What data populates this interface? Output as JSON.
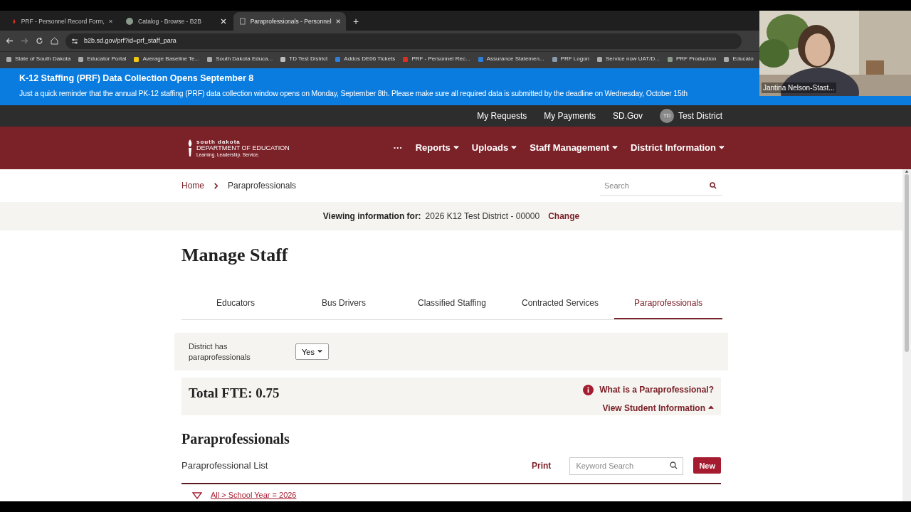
{
  "browser": {
    "tabs": [
      {
        "title": "PRF - Personnel Record Form,",
        "selected": false
      },
      {
        "title": "Catalog - Browse - B2B",
        "selected": false
      },
      {
        "title": "Paraprofessionals - Personnel",
        "selected": true
      }
    ],
    "new_tab": "+",
    "url": "b2b.sd.gov/prf?id=prf_staff_para",
    "bookmarks": [
      "State of South Dakota",
      "Educator Portal",
      "Average Baseline Te...",
      "South Dakota Educa...",
      "TD Test District",
      "Addos DE06 Tickets",
      "PRF - Personnel Rec...",
      "Assurance Statemen...",
      "PRF Logon",
      "Service now UAT/D...",
      "PRF Production",
      "Educato"
    ]
  },
  "banner": {
    "title": "K-12 Staffing (PRF) Data Collection Opens September 8",
    "text": "Just a quick reminder that the annual PK-12 staffing (PRF) data collection window opens on Monday, September 8th. Please make sure all required data is submitted by the deadline on Wednesday, October 15th"
  },
  "video_overlay": {
    "kind": "picture",
    "name": "Jantina Nelson-Stast..."
  },
  "utility_bar": {
    "links": [
      "My Requests",
      "My Payments",
      "SD.Gov"
    ],
    "user": {
      "initials": "TD",
      "name": "Test District"
    }
  },
  "header": {
    "logo": {
      "line1": "south dakota",
      "line2": "DEPARTMENT OF EDUCATION",
      "tagline": "Learning. Leadership. Service."
    },
    "more": "···",
    "menu": [
      "Reports",
      "Uploads",
      "Staff Management",
      "District Information"
    ]
  },
  "breadcrumb": [
    "Home",
    "Paraprofessionals"
  ],
  "search": {
    "placeholder": "Search"
  },
  "viewing": {
    "label": "Viewing information for:",
    "value": "2026 K12 Test District - 00000",
    "action": "Change"
  },
  "page_title": "Manage Staff",
  "tabs": [
    {
      "label": "Educators",
      "selected": false
    },
    {
      "label": "Bus Drivers",
      "selected": false
    },
    {
      "label": "Classified Staffing",
      "selected": false
    },
    {
      "label": "Contracted Services",
      "selected": false
    },
    {
      "label": "Paraprofessionals",
      "selected": true
    }
  ],
  "district_has": {
    "label": "District has paraprofessionals",
    "value": "Yes"
  },
  "fte": {
    "text": "Total FTE: 0.75",
    "help_link": "What is a Paraprofessional?",
    "student_link": "View Student Information"
  },
  "section_title": "Paraprofessionals",
  "list": {
    "title": "Paraprofessional List",
    "print": "Print",
    "search_placeholder": "Keyword Search",
    "new": "New",
    "filter": "All > School Year = 2026"
  }
}
